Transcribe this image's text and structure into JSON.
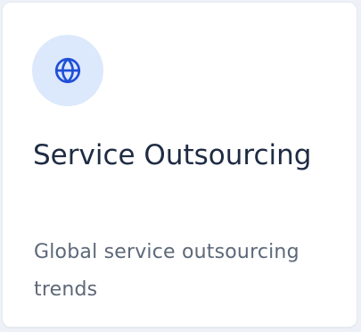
{
  "card": {
    "icon": "globe-icon",
    "title": "Service Outsourcing",
    "description": "Global service outsourcing trends"
  },
  "colors": {
    "icon_background": "#dce8fb",
    "icon_stroke": "#1f4fd8",
    "title": "#1e2b43",
    "description": "#5d6878"
  }
}
